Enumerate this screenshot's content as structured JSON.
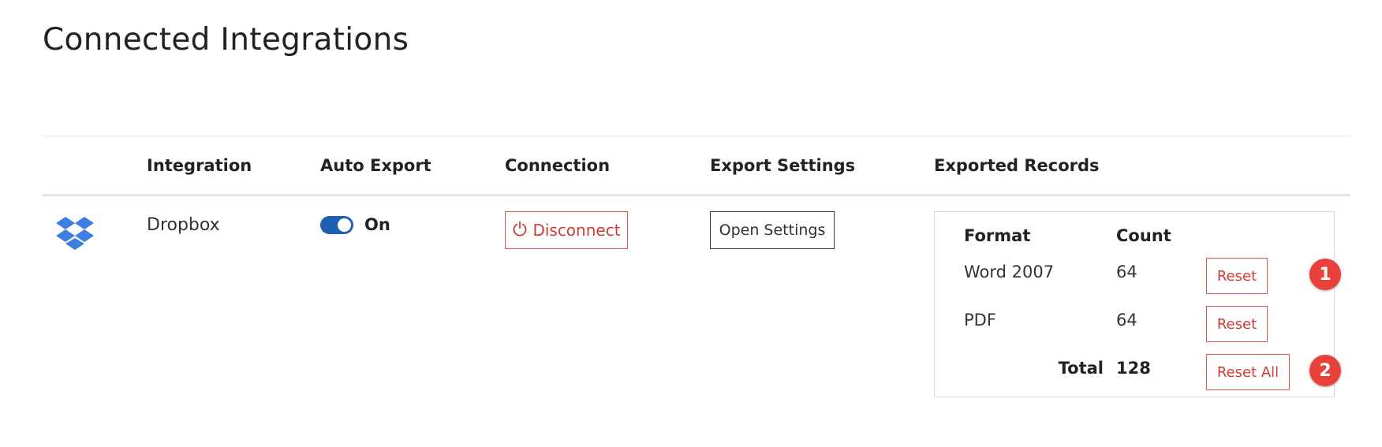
{
  "page": {
    "title": "Connected Integrations"
  },
  "table": {
    "headers": {
      "integration": "Integration",
      "auto_export": "Auto Export",
      "connection": "Connection",
      "export_settings": "Export Settings",
      "exported_records": "Exported Records"
    },
    "rows": [
      {
        "icon": "dropbox-icon",
        "name": "Dropbox",
        "auto_export": {
          "state": "On",
          "enabled": true
        },
        "connection": {
          "button_label": "Disconnect",
          "icon": "power-icon"
        },
        "export_settings": {
          "button_label": "Open Settings"
        },
        "exported_records": {
          "headers": {
            "format": "Format",
            "count": "Count"
          },
          "items": [
            {
              "format": "Word 2007",
              "count": "64",
              "action": "Reset"
            },
            {
              "format": "PDF",
              "count": "64",
              "action": "Reset"
            }
          ],
          "total": {
            "label": "Total",
            "count": "128",
            "action": "Reset All"
          }
        }
      }
    ]
  },
  "annotations": [
    {
      "number": "1"
    },
    {
      "number": "2"
    }
  ],
  "colors": {
    "accent": "#1f5fb3",
    "danger": "#d03b36",
    "marker": "#e8413b",
    "dropbox_blue": "#3d7fe0"
  }
}
